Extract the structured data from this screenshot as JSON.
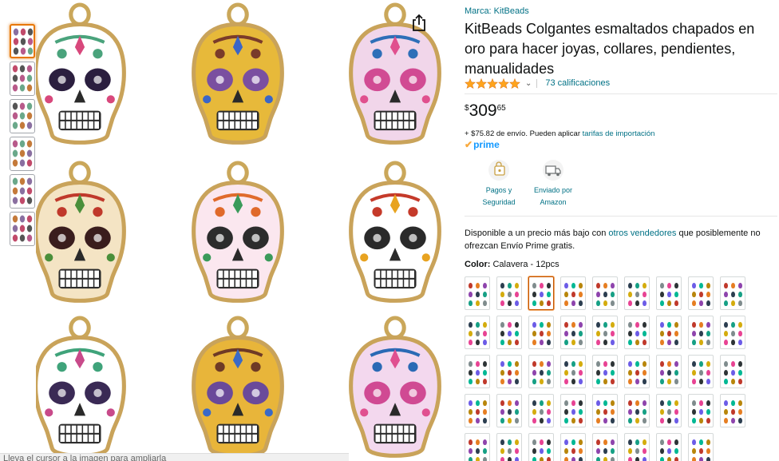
{
  "brand_line": "Marca: KitBeads",
  "title": "KitBeads Colgantes esmaltados chapados en oro para hacer joyas, collares, pendientes, manualidades",
  "rating": {
    "stars": 5,
    "count_text": "73 calificaciones",
    "star_color": "#ffa41c"
  },
  "price": {
    "symbol": "$",
    "whole": "309",
    "fraction": "65"
  },
  "shipping": {
    "text": "+ $75.82 de envío. Pueden aplicar ",
    "link": "tarifas de importación"
  },
  "prime_label": "prime",
  "features": [
    {
      "icon": "lock-card-icon",
      "line1": "Pagos y",
      "line2": "Seguridad"
    },
    {
      "icon": "truck-icon",
      "line1": "Enviado por",
      "line2": "Amazon"
    }
  ],
  "availability": {
    "before": "Disponible a un precio más bajo con ",
    "link": "otros vendedores",
    "after": " que posiblemente no ofrezcan Envío Prime gratis."
  },
  "color": {
    "label": "Color:",
    "value": "Calavera - 12pcs"
  },
  "swatch_count": 44,
  "selected_swatch": 2,
  "thumbnail_count": 6,
  "selected_thumbnail": 0,
  "scroll_hint": "Lleva el cursor a la imagen para ampliarla",
  "colors": {
    "link": "#007185",
    "accent": "#e77600",
    "prime": "#1399ff"
  }
}
